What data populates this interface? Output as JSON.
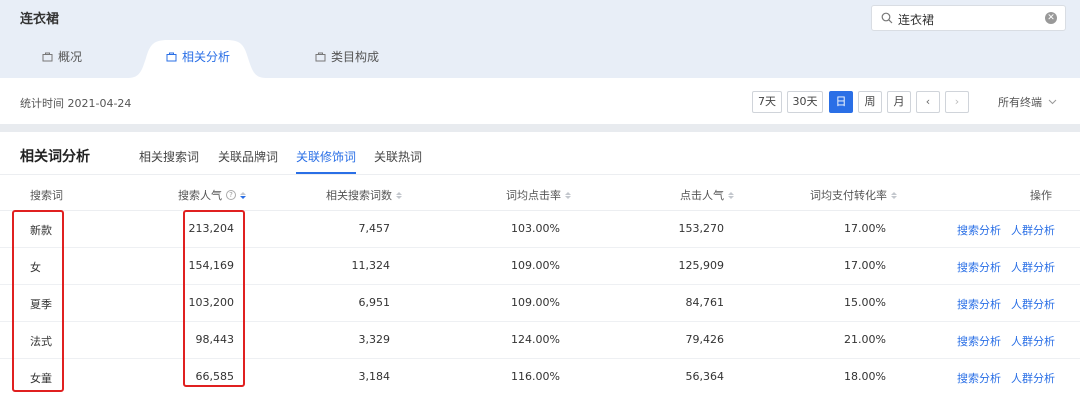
{
  "header": {
    "title": "连衣裙",
    "search": {
      "value": "连衣裙"
    },
    "tabs": [
      {
        "label": "概况"
      },
      {
        "label": "相关分析"
      },
      {
        "label": "类目构成"
      }
    ]
  },
  "filter": {
    "stat_time": "统计时间 2021-04-24",
    "ranges": [
      "7天",
      "30天",
      "日",
      "周",
      "月"
    ],
    "active_range": "日",
    "terminal": "所有终端"
  },
  "section": {
    "title": "相关词分析",
    "tabs": [
      "相关搜索词",
      "关联品牌词",
      "关联修饰词",
      "关联热词"
    ],
    "active_tab": "关联修饰词"
  },
  "table": {
    "columns": [
      "搜索词",
      "搜索人气",
      "相关搜索词数",
      "词均点击率",
      "点击人气",
      "词均支付转化率",
      "操作"
    ],
    "rows": [
      {
        "word": "新款",
        "popularity": "213,204",
        "related": "7,457",
        "ctr": "103.00%",
        "clicks": "153,270",
        "cvr": "17.00%",
        "a1": "搜索分析",
        "a2": "人群分析"
      },
      {
        "word": "女",
        "popularity": "154,169",
        "related": "11,324",
        "ctr": "109.00%",
        "clicks": "125,909",
        "cvr": "17.00%",
        "a1": "搜索分析",
        "a2": "人群分析"
      },
      {
        "word": "夏季",
        "popularity": "103,200",
        "related": "6,951",
        "ctr": "109.00%",
        "clicks": "84,761",
        "cvr": "15.00%",
        "a1": "搜索分析",
        "a2": "人群分析"
      },
      {
        "word": "法式",
        "popularity": "98,443",
        "related": "3,329",
        "ctr": "124.00%",
        "clicks": "79,426",
        "cvr": "21.00%",
        "a1": "搜索分析",
        "a2": "人群分析"
      },
      {
        "word": "女童",
        "popularity": "66,585",
        "related": "3,184",
        "ctr": "116.00%",
        "clicks": "56,364",
        "cvr": "18.00%",
        "a1": "搜索分析",
        "a2": "人群分析"
      }
    ]
  },
  "colors": {
    "accent": "#2a6fe6",
    "highlight": "#e02020",
    "header_bg": "#e8eef7"
  },
  "icons": [
    "search-icon",
    "clear-icon",
    "bag-icon",
    "chevron-left-icon",
    "chevron-right-icon",
    "chevron-down-icon",
    "help-icon",
    "sort-icon"
  ]
}
